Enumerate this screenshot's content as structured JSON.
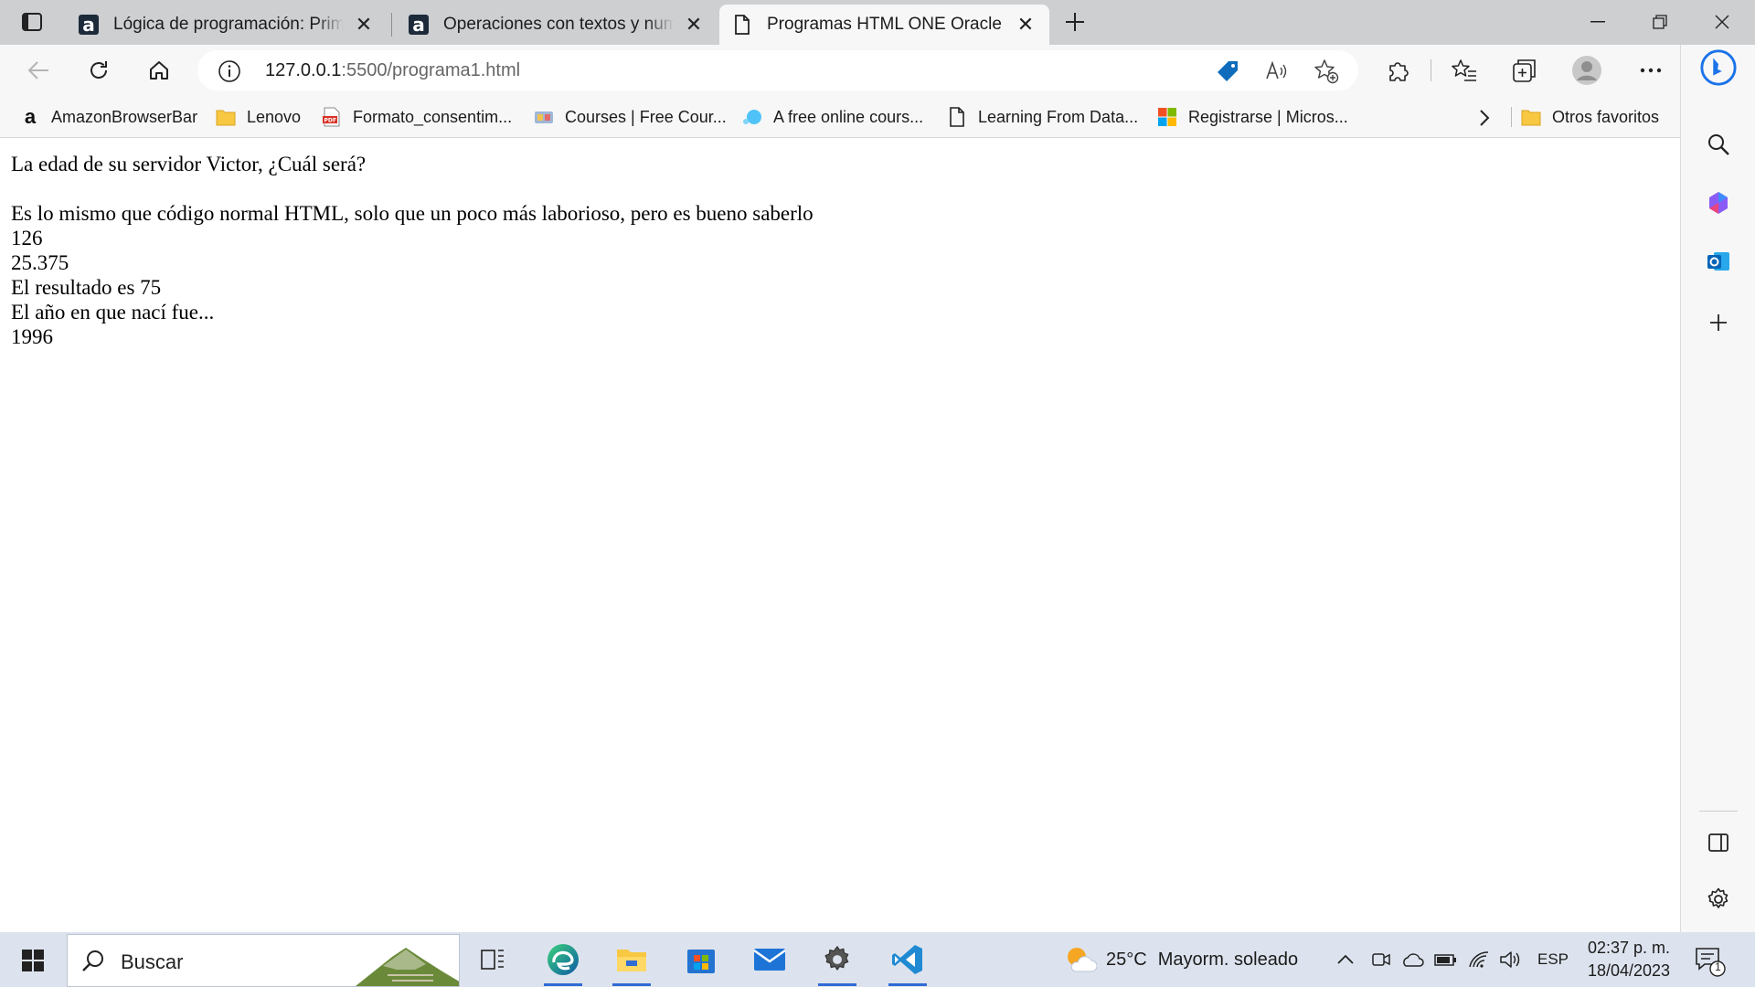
{
  "browser": {
    "tabs": [
      {
        "title": "Lógica de programación: Primeros pasos",
        "favicon": "alura-icon",
        "active": false
      },
      {
        "title": "Operaciones con textos y numeros",
        "favicon": "alura-icon",
        "active": false
      },
      {
        "title": "Programas HTML ONE Oracle",
        "favicon": "page-icon",
        "active": true
      }
    ],
    "address": {
      "host": "127.0.0.1",
      "path": ":5500/programa1.html"
    },
    "favorites": [
      {
        "label": "AmazonBrowserBar",
        "icon": "amazon-icon"
      },
      {
        "label": "Lenovo",
        "icon": "folder-icon"
      },
      {
        "label": "Formato_consentim...",
        "icon": "pdf-icon"
      },
      {
        "label": "Courses | Free Cour...",
        "icon": "courses-icon"
      },
      {
        "label": "A free online cours...",
        "icon": "course-bubble-icon"
      },
      {
        "label": "Learning From Data...",
        "icon": "page-icon"
      },
      {
        "label": "Registrarse | Micros...",
        "icon": "microsoft-icon"
      }
    ],
    "other_favorites": "Otros favoritos",
    "colors": {
      "tabstrip": "#cecfd1",
      "toolbar": "#f7f7f7",
      "accent": "#0f6cbd"
    }
  },
  "page": {
    "lines": [
      "La edad de su servidor Victor, ¿Cuál será?",
      "",
      "Es lo mismo que código normal HTML, solo que un poco más laborioso, pero es bueno saberlo",
      "126",
      "25.375",
      "El resultado es 75",
      "El año en que nací fue...",
      "1996"
    ]
  },
  "taskbar": {
    "search_placeholder": "Buscar",
    "apps": [
      "task-view-icon",
      "edge-icon",
      "file-explorer-icon",
      "store-icon",
      "mail-icon",
      "settings-icon",
      "vscode-icon"
    ],
    "weather": {
      "temp": "25°C",
      "condition": "Mayorm. soleado"
    },
    "language": "ESP",
    "time": "02:37 p. m.",
    "date": "18/04/2023",
    "notifications": "1"
  }
}
